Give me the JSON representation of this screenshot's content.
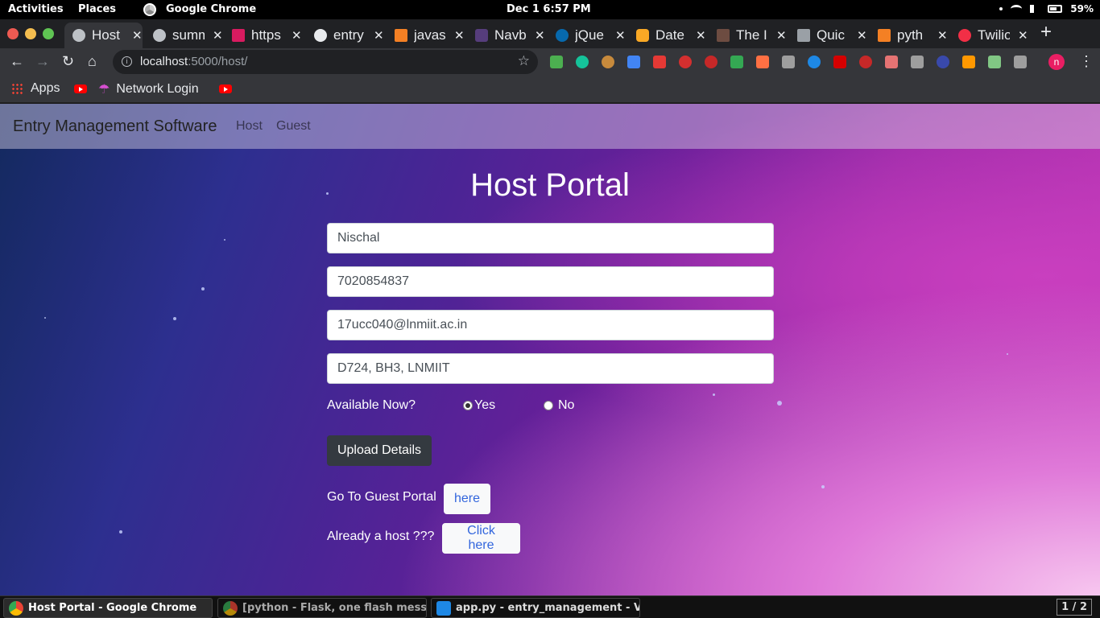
{
  "system_bar": {
    "activities": "Activities",
    "places": "Places",
    "app_name": "Google Chrome",
    "clock": "Dec 1   6:57 PM",
    "battery": "59%"
  },
  "tabs": [
    {
      "title": "Host Portal",
      "active": true,
      "icon": "globe-icon"
    },
    {
      "title": "summ",
      "icon": "globe-icon"
    },
    {
      "title": "https",
      "icon": "feather-icon"
    },
    {
      "title": "entry",
      "icon": "github-icon"
    },
    {
      "title": "javas",
      "icon": "stackoverflow-icon"
    },
    {
      "title": "Navb",
      "icon": "bootstrap-icon"
    },
    {
      "title": "jQue",
      "icon": "jquery-icon"
    },
    {
      "title": "Date",
      "icon": "shield-icon"
    },
    {
      "title": "The I",
      "icon": "photo-icon"
    },
    {
      "title": "Quic",
      "icon": "book-icon"
    },
    {
      "title": "pyth",
      "icon": "stackoverflow-icon"
    },
    {
      "title": "Twilio",
      "icon": "twilio-icon"
    }
  ],
  "toolbar": {
    "url_host": "localhost",
    "url_path": ":5000/host/"
  },
  "bookmarks": {
    "apps": "Apps",
    "network_login": "Network Login"
  },
  "navbar": {
    "brand": "Entry Management Software",
    "links": [
      "Host",
      "Guest"
    ]
  },
  "form": {
    "title": "Host Portal",
    "name": "Nischal",
    "phone": "7020854837",
    "email": "17ucc040@lnmiit.ac.in",
    "address": "D724, BH3, LNMIIT",
    "available_label": "Available Now?",
    "yes_label": "Yes",
    "no_label": "No",
    "available": "Yes",
    "submit_label": "Upload Details",
    "guest_portal_label": "Go To Guest Portal",
    "guest_portal_button": "here",
    "already_host_label": "Already a host ???",
    "already_host_button": "Click here"
  },
  "taskbar": {
    "items": [
      "Host Portal - Google Chrome",
      "[python - Flask, one flash messag...",
      "app.py - entry_management - Vis..."
    ],
    "pager": "1 / 2"
  },
  "colors": {
    "navbar_bg": "#dcd2e6",
    "button_dark": "#343a40",
    "link_blue": "#3366dd"
  }
}
